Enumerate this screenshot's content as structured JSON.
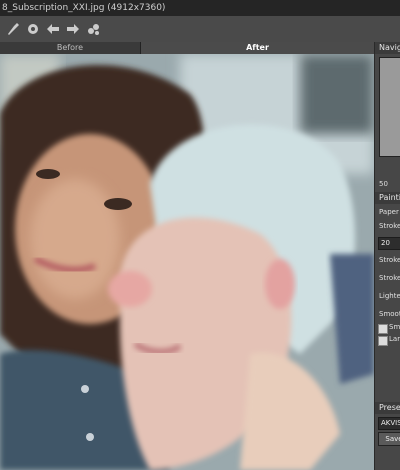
{
  "window": {
    "title": "8_Subscription_XXI.jpg (4912x7360)"
  },
  "toolbar": {
    "icons": [
      "brush-icon",
      "settings-icon",
      "undo-icon",
      "redo-icon",
      "effects-icon"
    ]
  },
  "tabs": {
    "before": "Before",
    "after": "After"
  },
  "panel": {
    "navigator_header": "Navigat",
    "zoom_value": "50",
    "painting_header": "Painting",
    "params": {
      "paper_color": "Paper Co",
      "stroke_thickness": "Stroke T",
      "stroke_value": "20",
      "stroke_intensity": "Stroke In",
      "stroke_density": "Stroke D",
      "lightening": "Lightenin",
      "smoothness": "Smoothne"
    },
    "checks": {
      "small": "Small",
      "large": "Large"
    },
    "presets_header": "Presets",
    "preset_value": "AKVIS S",
    "save_label": "Save"
  }
}
